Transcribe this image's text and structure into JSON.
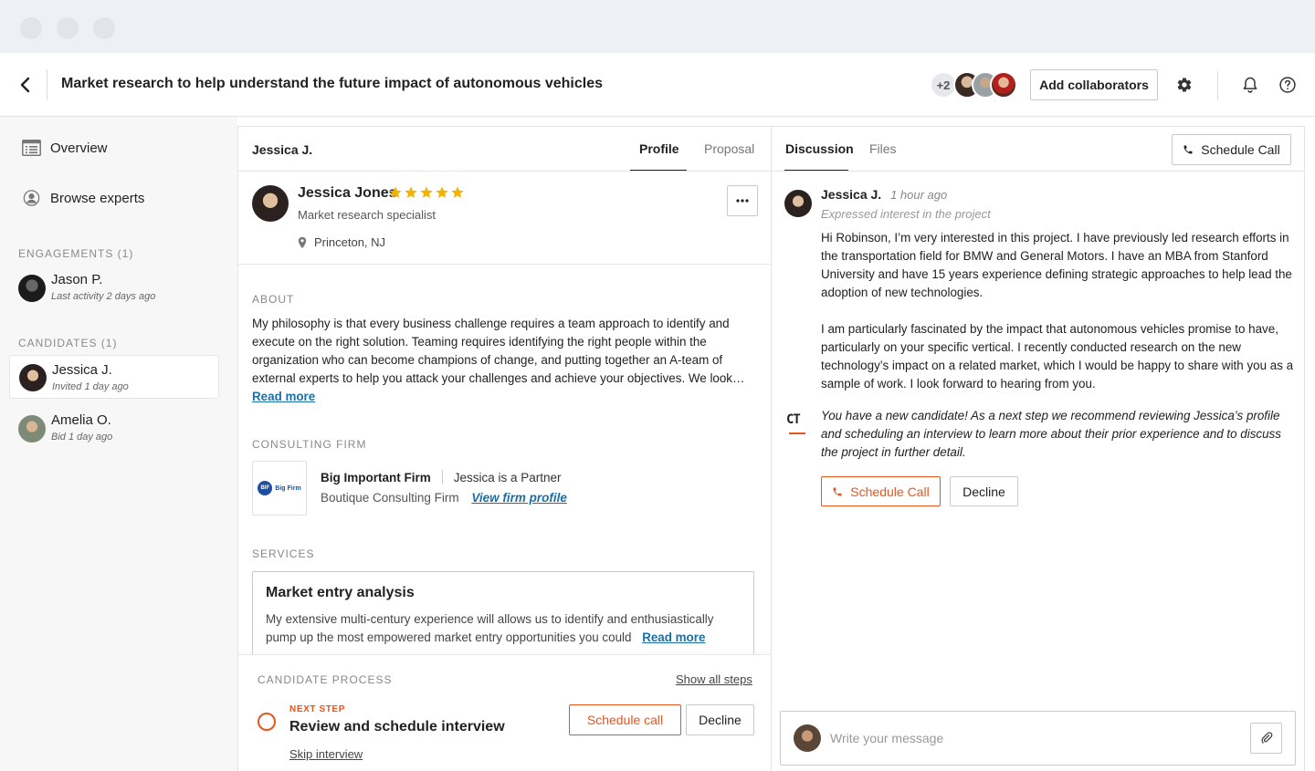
{
  "header": {
    "title": "Market research to help understand the future impact of autonomous vehicles",
    "collaborators_more": "+2",
    "add_collaborators_label": "Add collaborators"
  },
  "sidebar": {
    "nav": [
      {
        "label": "Overview",
        "icon": "list-icon"
      },
      {
        "label": "Browse experts",
        "icon": "user-circle-icon"
      }
    ],
    "engagements_label": "ENGAGEMENTS (1)",
    "engagements": [
      {
        "name": "Jason P.",
        "sub": "Last activity 2 days ago"
      }
    ],
    "candidates_label": "CANDIDATES (1)",
    "candidates": [
      {
        "name": "Jessica J.",
        "sub": "Invited 1 day ago"
      },
      {
        "name": "Amelia O.",
        "sub": "Bid 1 day ago"
      }
    ]
  },
  "profile": {
    "header_name": "Jessica J.",
    "tabs": [
      "Profile",
      "Proposal"
    ],
    "active_tab": "Profile",
    "name": "Jessica Jones",
    "rating": 5,
    "title": "Market research specialist",
    "location": "Princeton, NJ",
    "about_label": "ABOUT",
    "about_text": "My philosophy is that every business challenge requires a team approach to identify and execute on the right solution.  Teaming requires identifying the right people within the organization who can become champions of change, and putting together an A-team of external experts to help you attack your challenges and achieve your objectives.  We look…",
    "read_more": "Read more",
    "firm_label": "CONSULTING FIRM",
    "firm_logo_text": "BIF",
    "firm_logo_name": "Big Firm",
    "firm_name": "Big Important Firm",
    "firm_role": "Jessica is a Partner",
    "firm_type": "Boutique Consulting Firm",
    "firm_link": "View firm profile",
    "services_label": "SERVICES",
    "service_title": "Market entry analysis",
    "service_desc": "My extensive multi-century experience will allows us to identify and enthusiastically pump up the most empowered market entry opportunities you could",
    "service_read_more": "Read more"
  },
  "process": {
    "label": "CANDIDATE PROCESS",
    "show_all": "Show all steps",
    "next_step": "NEXT STEP",
    "step_title": "Review and schedule interview",
    "schedule": "Schedule call",
    "decline": "Decline",
    "skip": "Skip interview"
  },
  "discussion": {
    "tabs": [
      "Discussion",
      "Files"
    ],
    "active_tab": "Discussion",
    "schedule_call": "Schedule Call",
    "message": {
      "author": "Jessica J.",
      "time": "1 hour ago",
      "sub": "Expressed interest in the project",
      "p1": "Hi Robinson, I’m very interested in this project. I have previously led research efforts in the transportation field for BMW and General Motors. I have an MBA from Stanford University and have 15 years experience defining strategic approaches to help lead the adoption of new technologies.",
      "p2": "I am particularly fascinated by the impact that autonomous vehicles promise to have, particularly on your specific vertical. I recently conducted research on the new technology’s impact on a related market, which I would be happy to share with you as a sample of work. I look forward to hearing from you."
    },
    "system_logo": "CT",
    "system_message": "You have a new candidate! As a next step we recommend reviewing Jessica’s profile and scheduling an interview to learn more about their prior experience and to discuss the project in further detail.",
    "sys_schedule": "Schedule Call",
    "sys_decline": "Decline",
    "composer_placeholder": "Write your message"
  },
  "colors": {
    "accent": "#e8541e",
    "link": "#1a6fa8",
    "star": "#f5b301"
  }
}
